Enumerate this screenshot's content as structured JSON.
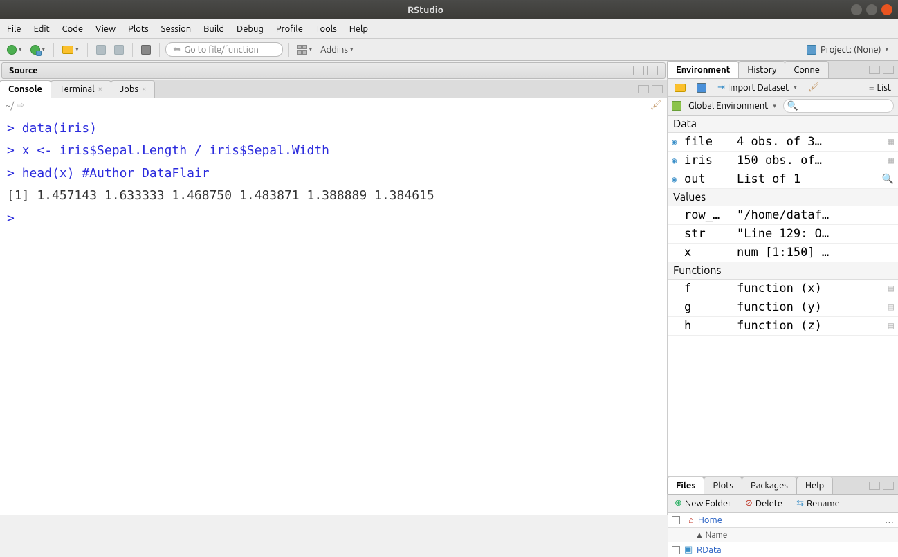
{
  "window": {
    "title": "RStudio"
  },
  "menu": {
    "file": "File",
    "edit": "Edit",
    "code": "Code",
    "view": "View",
    "plots": "Plots",
    "session": "Session",
    "build": "Build",
    "debug": "Debug",
    "profile": "Profile",
    "tools": "Tools",
    "help": "Help"
  },
  "toolbar": {
    "goto_placeholder": "Go to file/function",
    "addins": "Addins",
    "project_label": "Project: (None)"
  },
  "source_pane": {
    "title": "Source"
  },
  "console_tabs": {
    "console": "Console",
    "terminal": "Terminal",
    "jobs": "Jobs"
  },
  "console": {
    "path": "~/",
    "lines": [
      {
        "type": "in",
        "text": "data(iris)"
      },
      {
        "type": "in",
        "text": "x <- iris$Sepal.Length / iris$Sepal.Width"
      },
      {
        "type": "in",
        "text": "head(x)     #Author DataFlair"
      },
      {
        "type": "out",
        "text": "[1] 1.457143 1.633333 1.468750 1.483871 1.388889 1.384615"
      },
      {
        "type": "in",
        "text": ""
      }
    ]
  },
  "env_tabs": {
    "environment": "Environment",
    "history": "History",
    "connections": "Conne"
  },
  "env_toolbar": {
    "import": "Import Dataset",
    "list": "List"
  },
  "env_scope": {
    "label": "Global Environment"
  },
  "env": {
    "sections": {
      "data": "Data",
      "values": "Values",
      "functions": "Functions"
    },
    "data": [
      {
        "name": "file",
        "val": "4 obs. of 3…",
        "expand": true,
        "grid": true
      },
      {
        "name": "iris",
        "val": "150 obs. of…",
        "expand": true,
        "grid": true
      },
      {
        "name": "out",
        "val": "List of 1",
        "expand": true,
        "mag": true
      }
    ],
    "values": [
      {
        "name": "row_…",
        "val": "\"/home/dataf…"
      },
      {
        "name": "str",
        "val": "\"Line 129: O…"
      },
      {
        "name": "x",
        "val": "num [1:150] …"
      }
    ],
    "functions": [
      {
        "name": "f",
        "val": "function (x)",
        "doc": true
      },
      {
        "name": "g",
        "val": "function (y)",
        "doc": true
      },
      {
        "name": "h",
        "val": "function (z)",
        "doc": true
      }
    ]
  },
  "files_tabs": {
    "files": "Files",
    "plots": "Plots",
    "packages": "Packages",
    "help": "Help"
  },
  "files_toolbar": {
    "newfolder": "New Folder",
    "delete": "Delete",
    "rename": "Rename"
  },
  "files": {
    "home": "Home",
    "name_col": "Name",
    "rdata": "RData"
  }
}
